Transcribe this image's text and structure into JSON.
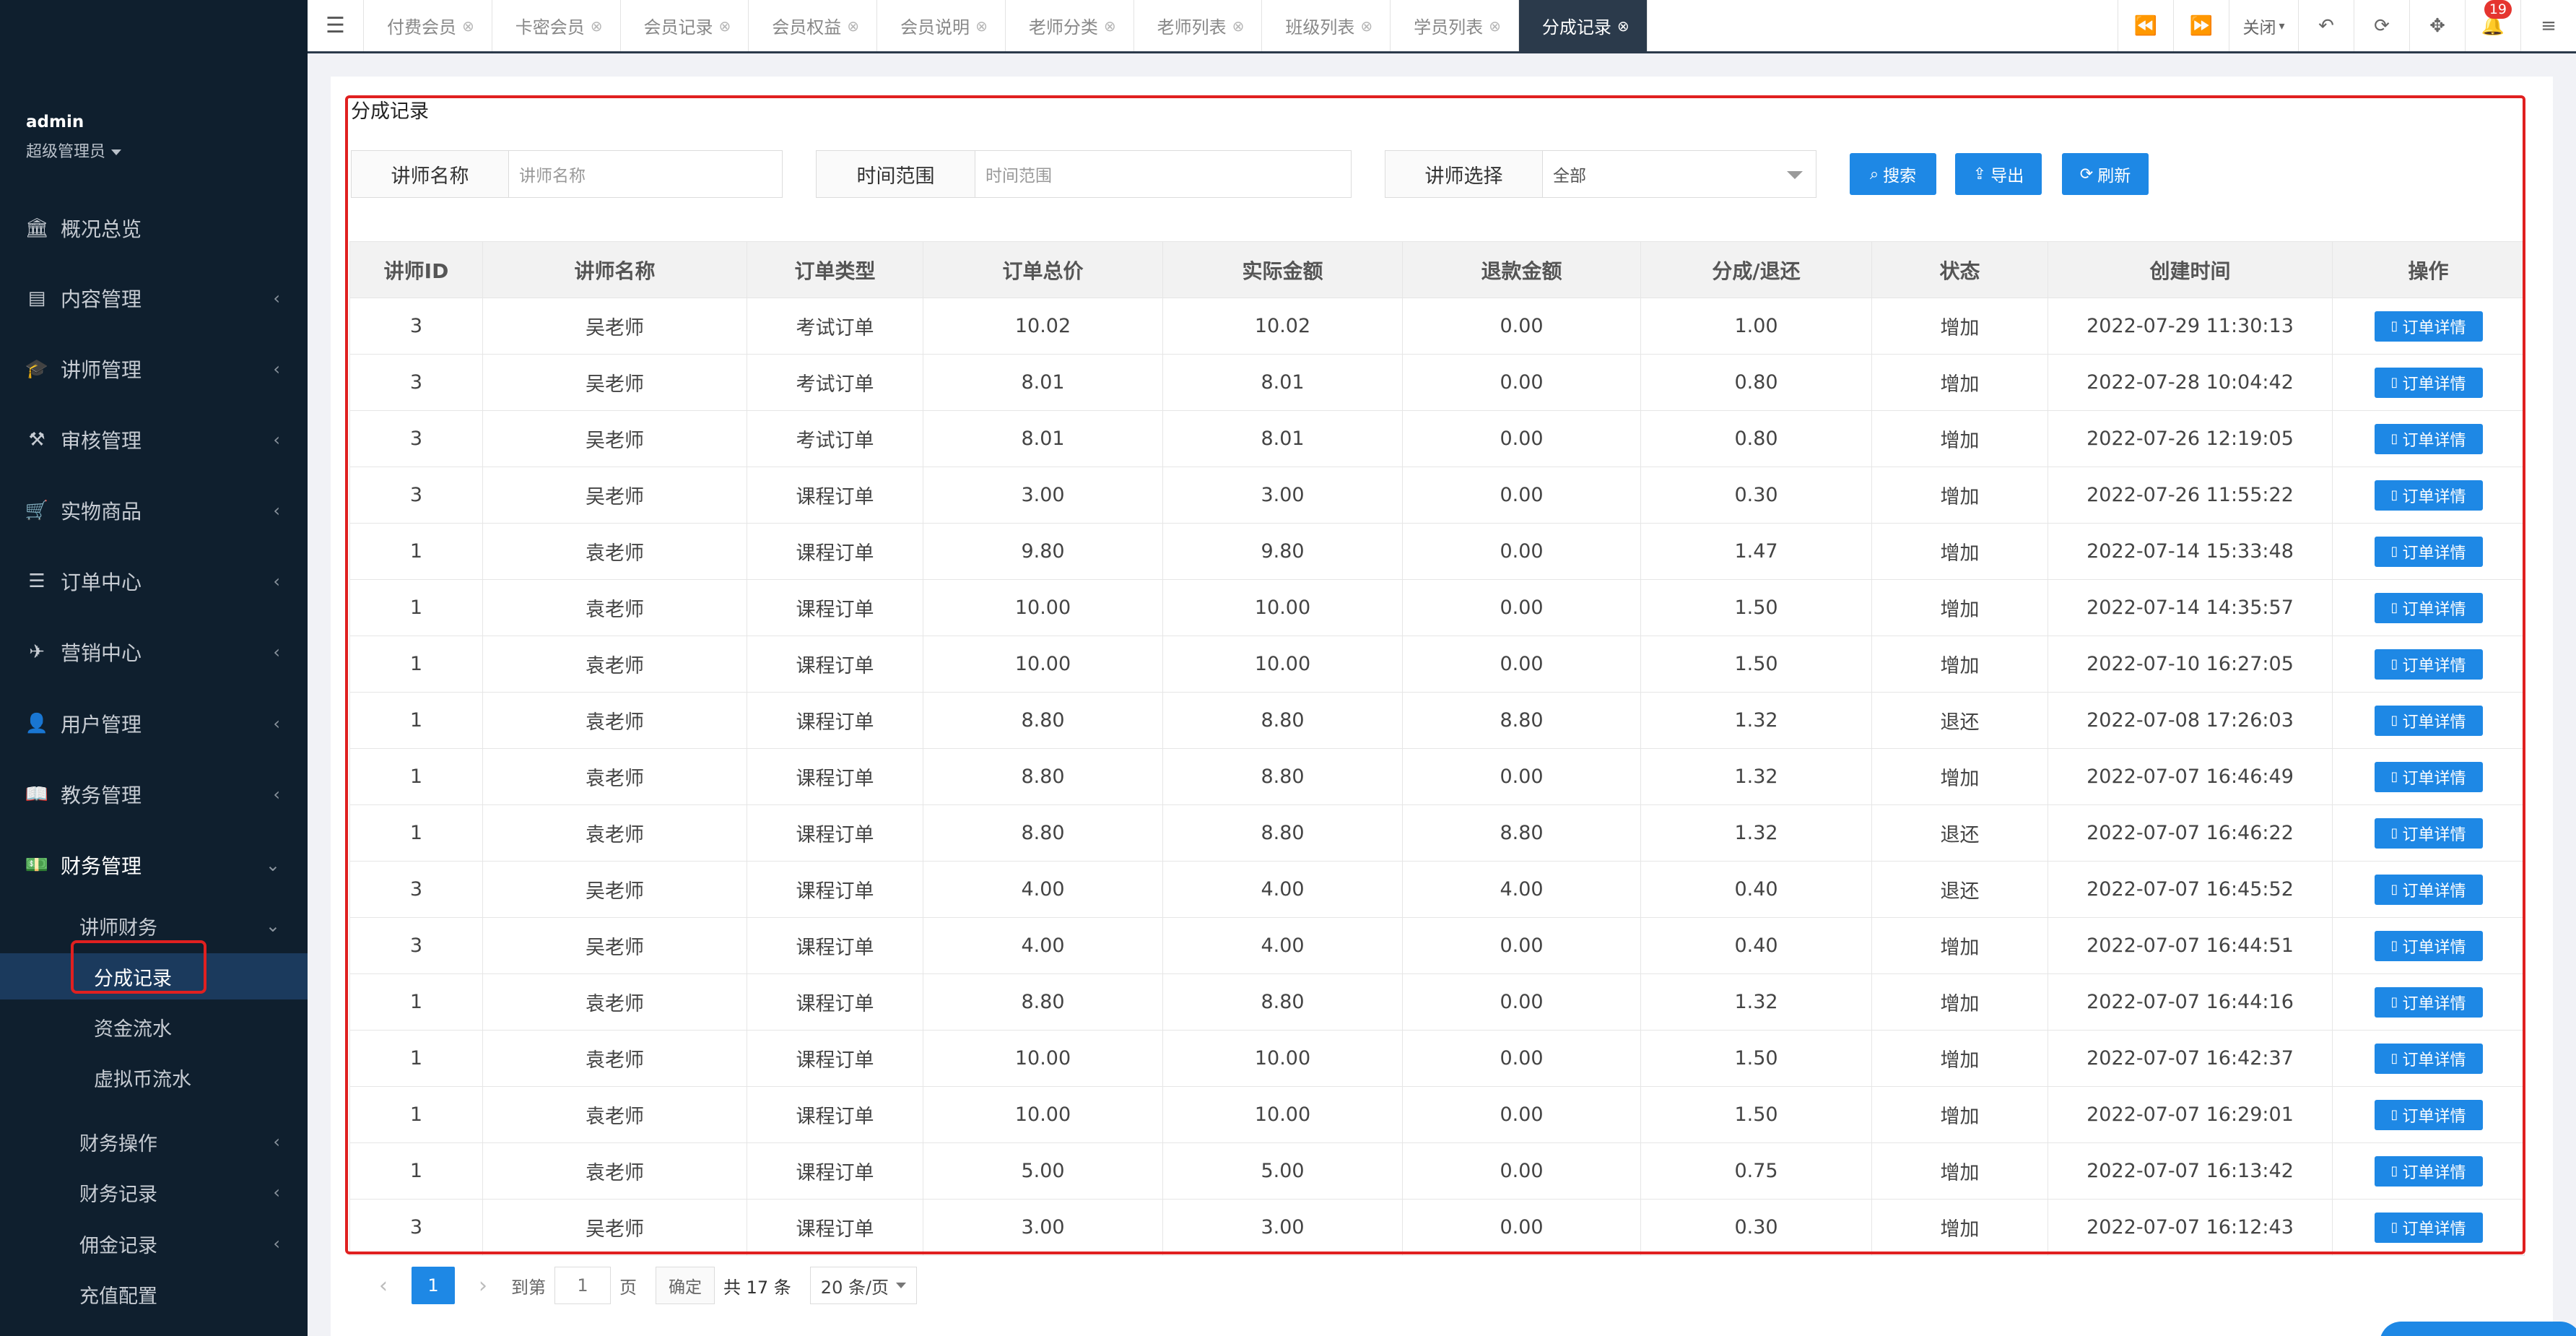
{
  "user": {
    "name": "admin",
    "role": "超级管理员"
  },
  "sidebar": {
    "items": [
      {
        "label": "概况总览",
        "icon": "bank-icon",
        "glyph": "🏛"
      },
      {
        "label": "内容管理",
        "icon": "newspaper-icon",
        "glyph": "▤"
      },
      {
        "label": "讲师管理",
        "icon": "graduation-cap-icon",
        "glyph": "🎓"
      },
      {
        "label": "审核管理",
        "icon": "gavel-icon",
        "glyph": "⚒"
      },
      {
        "label": "实物商品",
        "icon": "cart-icon",
        "glyph": "🛒"
      },
      {
        "label": "订单中心",
        "icon": "list-icon",
        "glyph": "☰"
      },
      {
        "label": "营销中心",
        "icon": "paper-plane-icon",
        "glyph": "✈"
      },
      {
        "label": "用户管理",
        "icon": "user-icon",
        "glyph": "👤"
      },
      {
        "label": "教务管理",
        "icon": "book-icon",
        "glyph": "📖"
      },
      {
        "label": "财务管理",
        "icon": "money-icon",
        "glyph": "💵"
      }
    ],
    "finance_sub": {
      "group": "讲师财务",
      "children": [
        "分成记录",
        "资金流水",
        "虚拟币流水"
      ],
      "others": [
        "财务操作",
        "财务记录",
        "佣金记录",
        "充值配置"
      ]
    }
  },
  "tabs": [
    "付费会员",
    "卡密会员",
    "会员记录",
    "会员权益",
    "会员说明",
    "老师分类",
    "老师列表",
    "班级列表",
    "学员列表",
    "分成记录"
  ],
  "toolbar": {
    "close_label": "关闭",
    "notification_count": "19"
  },
  "panel": {
    "title": "分成记录"
  },
  "filters": {
    "teacher_name": {
      "label": "讲师名称",
      "placeholder": "讲师名称"
    },
    "time_range": {
      "label": "时间范围",
      "placeholder": "时间范围"
    },
    "teacher_select": {
      "label": "讲师选择",
      "value": "全部"
    },
    "search_label": "搜索",
    "export_label": "导出",
    "refresh_label": "刷新"
  },
  "table": {
    "headers": [
      "讲师ID",
      "讲师名称",
      "订单类型",
      "订单总价",
      "实际金额",
      "退款金额",
      "分成/退还",
      "状态",
      "创建时间",
      "操作"
    ],
    "action_label": "订单详情",
    "rows": [
      [
        "3",
        "吴老师",
        "考试订单",
        "10.02",
        "10.02",
        "0.00",
        "1.00",
        "增加",
        "2022-07-29 11:30:13"
      ],
      [
        "3",
        "吴老师",
        "考试订单",
        "8.01",
        "8.01",
        "0.00",
        "0.80",
        "增加",
        "2022-07-28 10:04:42"
      ],
      [
        "3",
        "吴老师",
        "考试订单",
        "8.01",
        "8.01",
        "0.00",
        "0.80",
        "增加",
        "2022-07-26 12:19:05"
      ],
      [
        "3",
        "吴老师",
        "课程订单",
        "3.00",
        "3.00",
        "0.00",
        "0.30",
        "增加",
        "2022-07-26 11:55:22"
      ],
      [
        "1",
        "袁老师",
        "课程订单",
        "9.80",
        "9.80",
        "0.00",
        "1.47",
        "增加",
        "2022-07-14 15:33:48"
      ],
      [
        "1",
        "袁老师",
        "课程订单",
        "10.00",
        "10.00",
        "0.00",
        "1.50",
        "增加",
        "2022-07-14 14:35:57"
      ],
      [
        "1",
        "袁老师",
        "课程订单",
        "10.00",
        "10.00",
        "0.00",
        "1.50",
        "增加",
        "2022-07-10 16:27:05"
      ],
      [
        "1",
        "袁老师",
        "课程订单",
        "8.80",
        "8.80",
        "8.80",
        "1.32",
        "退还",
        "2022-07-08 17:26:03"
      ],
      [
        "1",
        "袁老师",
        "课程订单",
        "8.80",
        "8.80",
        "0.00",
        "1.32",
        "增加",
        "2022-07-07 16:46:49"
      ],
      [
        "1",
        "袁老师",
        "课程订单",
        "8.80",
        "8.80",
        "8.80",
        "1.32",
        "退还",
        "2022-07-07 16:46:22"
      ],
      [
        "3",
        "吴老师",
        "课程订单",
        "4.00",
        "4.00",
        "4.00",
        "0.40",
        "退还",
        "2022-07-07 16:45:52"
      ],
      [
        "3",
        "吴老师",
        "课程订单",
        "4.00",
        "4.00",
        "0.00",
        "0.40",
        "增加",
        "2022-07-07 16:44:51"
      ],
      [
        "1",
        "袁老师",
        "课程订单",
        "8.80",
        "8.80",
        "0.00",
        "1.32",
        "增加",
        "2022-07-07 16:44:16"
      ],
      [
        "1",
        "袁老师",
        "课程订单",
        "10.00",
        "10.00",
        "0.00",
        "1.50",
        "增加",
        "2022-07-07 16:42:37"
      ],
      [
        "1",
        "袁老师",
        "课程订单",
        "10.00",
        "10.00",
        "0.00",
        "1.50",
        "增加",
        "2022-07-07 16:29:01"
      ],
      [
        "1",
        "袁老师",
        "课程订单",
        "5.00",
        "5.00",
        "0.00",
        "0.75",
        "增加",
        "2022-07-07 16:13:42"
      ],
      [
        "3",
        "吴老师",
        "课程订单",
        "3.00",
        "3.00",
        "0.00",
        "0.30",
        "增加",
        "2022-07-07 16:12:43"
      ]
    ]
  },
  "pagination": {
    "current_page": "1",
    "goto_label": "到第",
    "goto_value": "1",
    "page_unit": "页",
    "confirm_label": "确定",
    "total_label": "共 17 条",
    "page_size": "20 条/页"
  },
  "colors": {
    "sidebar_bg": "#0f1f2e",
    "primary": "#1e88e5",
    "status_add": "#009688",
    "status_refund": "#ff5722",
    "highlight": "#e02020"
  }
}
